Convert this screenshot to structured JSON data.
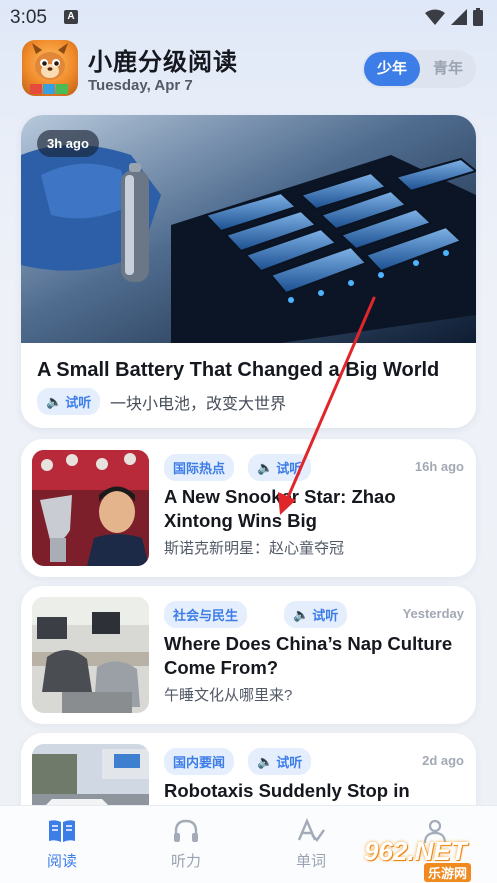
{
  "status_bar": {
    "time": "3:05",
    "notification_letter": "A"
  },
  "header": {
    "app_title": "小鹿分级阅读",
    "date": "Tuesday, Apr 7",
    "level_options": [
      "少年",
      "青年"
    ],
    "selected_level": "少年"
  },
  "hero": {
    "time_ago": "3h ago",
    "title": "A Small Battery That Changed a Big World",
    "listen_label": "试听",
    "subtitle": "一块小电池，改变大世界"
  },
  "articles": [
    {
      "tag": "国际热点",
      "listen_label": "试听",
      "time_ago": "16h ago",
      "title": "A New Snooker Star: Zhao Xintong Wins Big",
      "subtitle": "斯诺克新明星：赵心童夺冠"
    },
    {
      "tag": "社会与民生",
      "listen_label": "试听",
      "time_ago": "Yesterday",
      "title": "Where Does China’s Nap Culture Come From?",
      "subtitle": "午睡文化从哪里来?"
    },
    {
      "tag": "国内要闻",
      "listen_label": "试听",
      "time_ago": "2d ago",
      "title": "Robotaxis Suddenly Stop in",
      "subtitle": ""
    }
  ],
  "bottom_nav": [
    {
      "label": "阅读",
      "icon": "book-icon",
      "active": true
    },
    {
      "label": "听力",
      "icon": "headphones-icon",
      "active": false
    },
    {
      "label": "单词",
      "icon": "vocabulary-icon",
      "active": false
    },
    {
      "label": "",
      "icon": "profile-icon",
      "active": false
    }
  ],
  "watermark": {
    "text": "962.NET",
    "sub": "乐游网"
  },
  "colors": {
    "accent": "#3d7de8",
    "tag_bg": "#e5eefc",
    "annotation_arrow": "#e0262b"
  }
}
